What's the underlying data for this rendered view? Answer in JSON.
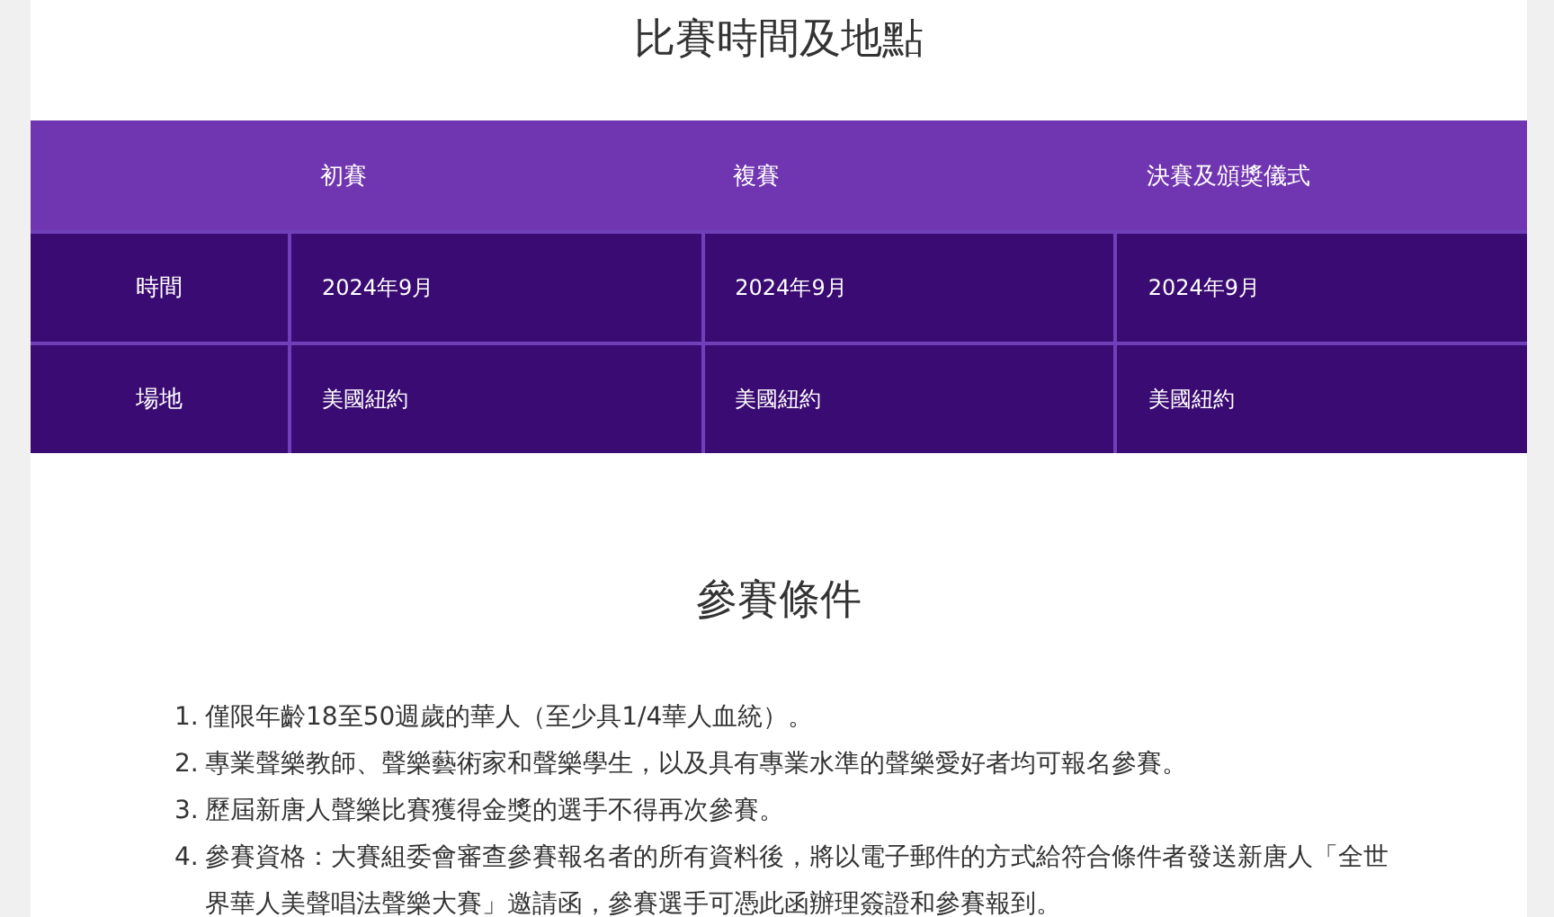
{
  "schedule": {
    "title": "比賽時間及地點",
    "columns": [
      "初賽",
      "複賽",
      "決賽及頒獎儀式"
    ],
    "rows": [
      {
        "label": "時間",
        "cells": [
          "2024年9月",
          "2024年9月",
          "2024年9月"
        ]
      },
      {
        "label": "場地",
        "cells": [
          "美國紐約",
          "美國紐約",
          "美國紐約"
        ]
      }
    ]
  },
  "conditions": {
    "title": "參賽條件",
    "items": [
      {
        "number": "1.",
        "text": "僅限年齡18至50週歲的華人（至少具1/4華人血統）。"
      },
      {
        "number": "2.",
        "text": "專業聲樂教師、聲樂藝術家和聲樂學生，以及具有專業水準的聲樂愛好者均可報名參賽。"
      },
      {
        "number": "3.",
        "text": "歷屆新唐人聲樂比賽獲得金獎的選手不得再次參賽。"
      },
      {
        "number": "4.",
        "text": "參賽資格：大賽組委會審查參賽報名者的所有資料後，將以電子郵件的方式給符合條件者發送新唐人「全世界華人美聲唱法聲樂大賽」邀請函，參賽選手可憑此函辦理簽證和參賽報到。"
      }
    ]
  }
}
